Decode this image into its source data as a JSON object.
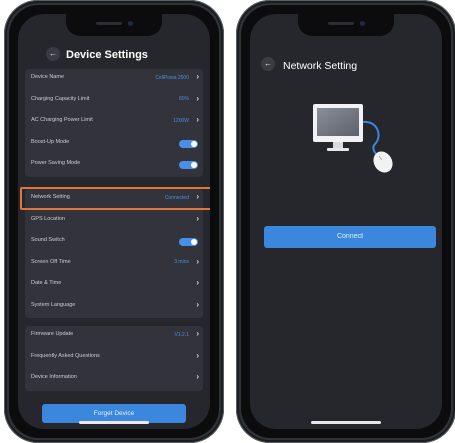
{
  "left_screen": {
    "title": "Device Settings",
    "back_icon": "arrow-left-icon",
    "groups": [
      [
        {
          "label": "Device Name",
          "value": "CellPowa 2500",
          "control": "chevron"
        },
        {
          "label": "Charging Capacity Limit",
          "value": "80%",
          "control": "chevron"
        },
        {
          "label": "AC Charging Power Limit",
          "value": "1200W",
          "control": "chevron"
        },
        {
          "label": "Boost-Up Mode",
          "value": "",
          "control": "toggle",
          "on": true
        },
        {
          "label": "Power Saving Mode",
          "value": "",
          "control": "toggle",
          "on": true
        }
      ],
      [
        {
          "label": "Network Setting",
          "value": "Connected",
          "control": "chevron",
          "highlighted": true
        },
        {
          "label": "GPS Location",
          "value": "",
          "control": "chevron"
        },
        {
          "label": "Sound Switch",
          "value": "",
          "control": "toggle",
          "on": true
        },
        {
          "label": "Screen Off Time",
          "value": "3 mins",
          "control": "chevron"
        },
        {
          "label": "Date & Time",
          "value": "",
          "control": "chevron"
        },
        {
          "label": "System Language",
          "value": "",
          "control": "chevron"
        }
      ],
      [
        {
          "label": "Firmware Update",
          "value": "V1.2.1",
          "control": "chevron"
        },
        {
          "label": "Frequently Asked Questions",
          "value": "",
          "control": "chevron"
        },
        {
          "label": "Device Information",
          "value": "",
          "control": "chevron"
        }
      ]
    ],
    "forget_button": "Forget Device"
  },
  "right_screen": {
    "title": "Network Setting",
    "back_icon": "arrow-left-icon",
    "illustration_icon": "computer-mouse-icon",
    "connect_button": "Connect"
  },
  "colors": {
    "screen_bg": "#26272d",
    "card_bg": "#33343b",
    "accent": "#3a87dd",
    "highlight": "#e0763a",
    "value_text": "#4a8fe7"
  },
  "glyphs": {
    "back": "←",
    "chevron": "›"
  }
}
